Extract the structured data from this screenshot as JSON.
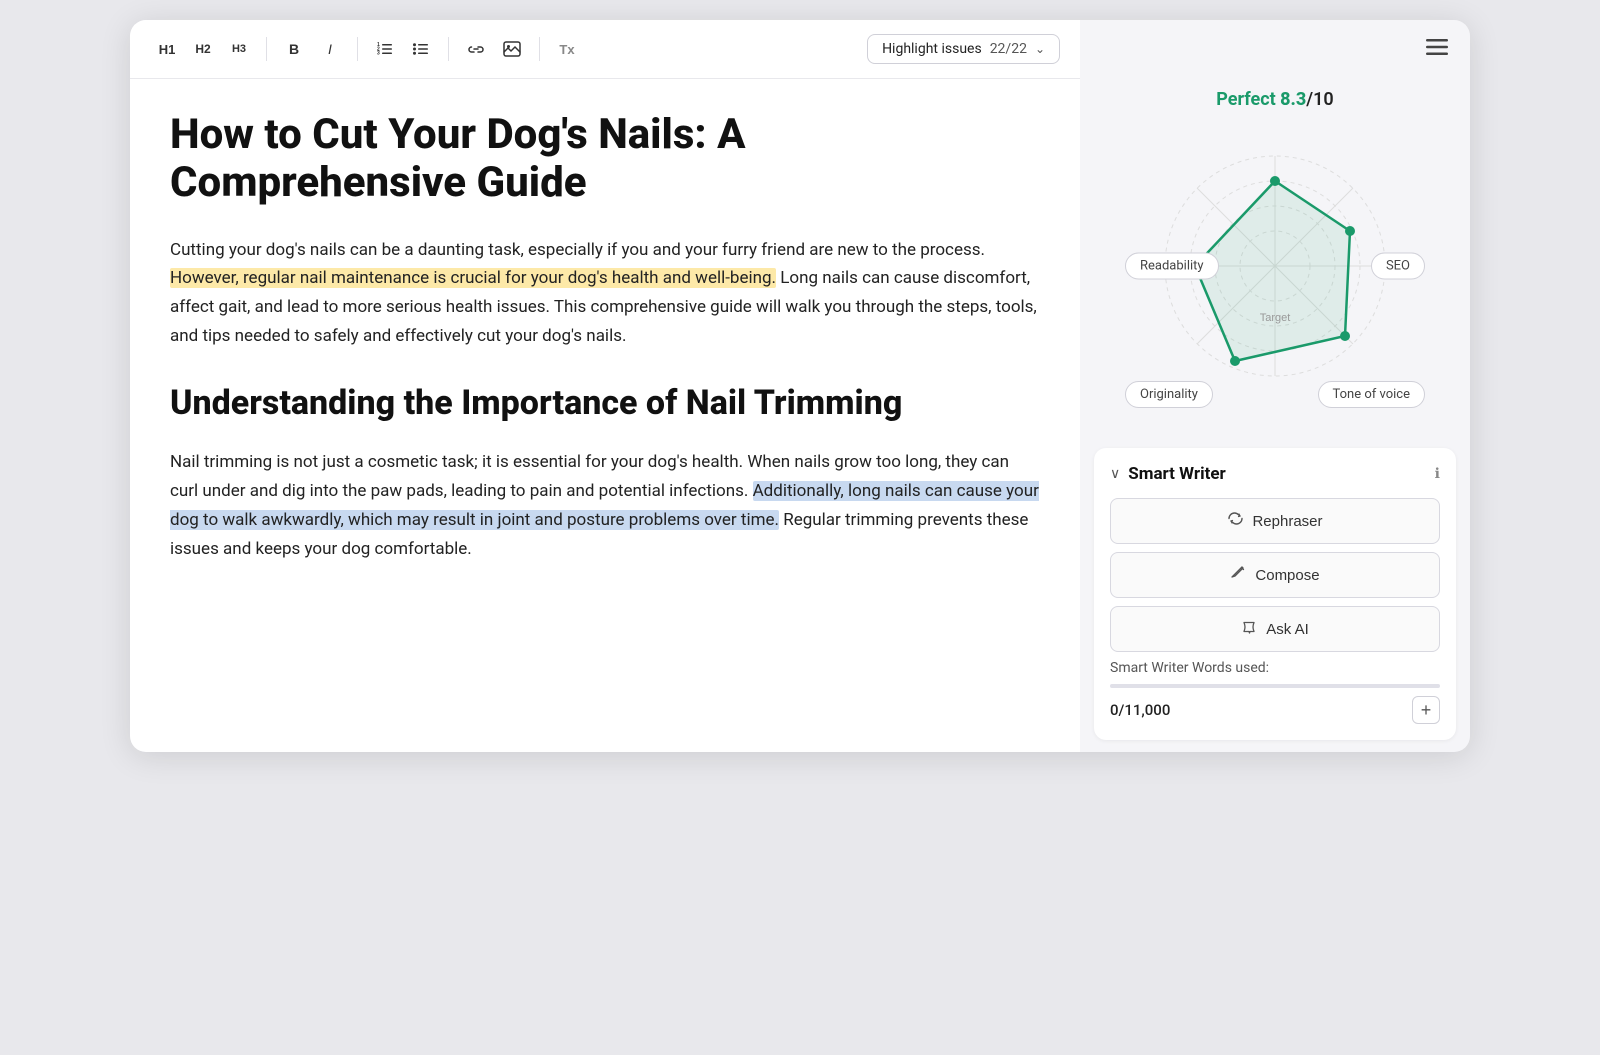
{
  "toolbar": {
    "h1_label": "H1",
    "h2_label": "H2",
    "h3_label": "H3",
    "bold_label": "B",
    "italic_label": "I",
    "ol_icon": "≡",
    "ul_icon": "≡",
    "link_icon": "🔗",
    "image_icon": "🖼",
    "clear_icon": "Tx",
    "highlight_label": "Highlight issues",
    "highlight_count": "22/22",
    "chevron": "⌄"
  },
  "article": {
    "title": "How to Cut Your Dog's Nails: A Comprehensive Guide",
    "intro": {
      "before_highlight1": "Cutting your dog's nails can be a daunting task, especially if you and your furry friend are new to the process. ",
      "highlight1": "However, regular nail maintenance is crucial for your dog's health and well-being.",
      "between_highlights": " Long nails can cause discomfort, affect gait, and lead to more serious health issues. This comprehensive guide will walk you through the steps, tools, and tips needed to safely and effectively cut your dog's nails."
    },
    "h2": "Understanding the Importance of Nail Trimming",
    "body2": {
      "before_highlight": "Nail trimming is not just a cosmetic task; it is essential for your dog's health. When nails grow too long, they can curl under and dig into the paw pads, leading to pain and potential infections. ",
      "highlight": "Additionally, long nails can cause your dog to walk awkwardly, which may result in joint and posture problems over time.",
      "after_highlight": " Regular trimming prevents these issues and keeps your dog comfortable."
    }
  },
  "sidebar": {
    "menu_icon": "≡",
    "score": {
      "prefix": "Perfect ",
      "number": "8.3",
      "suffix": "/10"
    },
    "radar": {
      "labels": {
        "readability": "Readability",
        "seo": "SEO",
        "originality": "Originality",
        "tone_of_voice": "Tone of voice"
      },
      "target_label": "Target"
    },
    "smart_writer": {
      "chevron": "∨",
      "title": "Smart Writer",
      "info_icon": "ℹ",
      "rephraser_label": "Rephraser",
      "compose_label": "Compose",
      "ask_ai_label": "Ask AI",
      "words_used_label": "Smart Writer Words used:",
      "words_used_count": "0/11,000",
      "add_icon": "+"
    }
  }
}
